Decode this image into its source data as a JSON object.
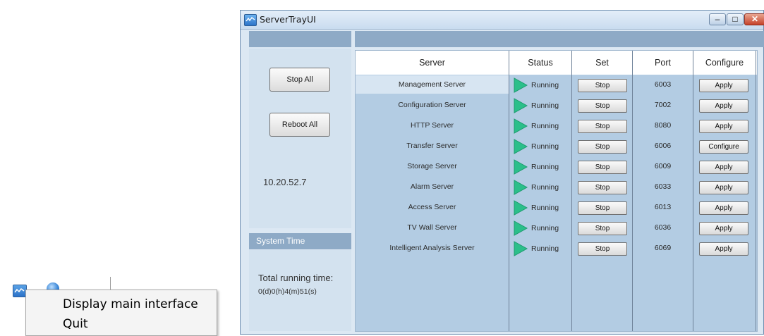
{
  "tray": {
    "menu_items": [
      "Display main interface",
      "Quit"
    ]
  },
  "window": {
    "title": "ServerTrayUI",
    "controls": {
      "minimize": "–",
      "maximize": "□",
      "close": "✕"
    }
  },
  "left_panel": {
    "stop_all_label": "Stop All",
    "reboot_all_label": "Reboot All",
    "ip_address": "10.20.52.7"
  },
  "system_time": {
    "title": "System Time",
    "total_label": "Total running time:",
    "total_value": "0(d)0(h)4(m)51(s)"
  },
  "table": {
    "columns": [
      "Server",
      "Status",
      "Set",
      "Port",
      "Configure"
    ],
    "rows": [
      {
        "server": "Management Server",
        "status": "Running",
        "set": "Stop",
        "port": "6003",
        "configure": "Apply"
      },
      {
        "server": "Configuration Server",
        "status": "Running",
        "set": "Stop",
        "port": "7002",
        "configure": "Apply"
      },
      {
        "server": "HTTP Server",
        "status": "Running",
        "set": "Stop",
        "port": "8080",
        "configure": "Apply"
      },
      {
        "server": "Transfer Server",
        "status": "Running",
        "set": "Stop",
        "port": "6006",
        "configure": "Configure"
      },
      {
        "server": "Storage Server",
        "status": "Running",
        "set": "Stop",
        "port": "6009",
        "configure": "Apply"
      },
      {
        "server": "Alarm Server",
        "status": "Running",
        "set": "Stop",
        "port": "6033",
        "configure": "Apply"
      },
      {
        "server": "Access Server",
        "status": "Running",
        "set": "Stop",
        "port": "6013",
        "configure": "Apply"
      },
      {
        "server": "TV Wall Server",
        "status": "Running",
        "set": "Stop",
        "port": "6036",
        "configure": "Apply"
      },
      {
        "server": "Intelligent Analysis Server",
        "status": "Running",
        "set": "Stop",
        "port": "6069",
        "configure": "Apply"
      }
    ]
  },
  "colors": {
    "panel_header": "#8eaac6",
    "table_bg": "#b3cce3",
    "running_icon": "#2bbf8a"
  },
  "icons": {
    "app": "server-tray-icon",
    "tray_other": "network-globe-icon",
    "status": "play-triangle-icon"
  }
}
